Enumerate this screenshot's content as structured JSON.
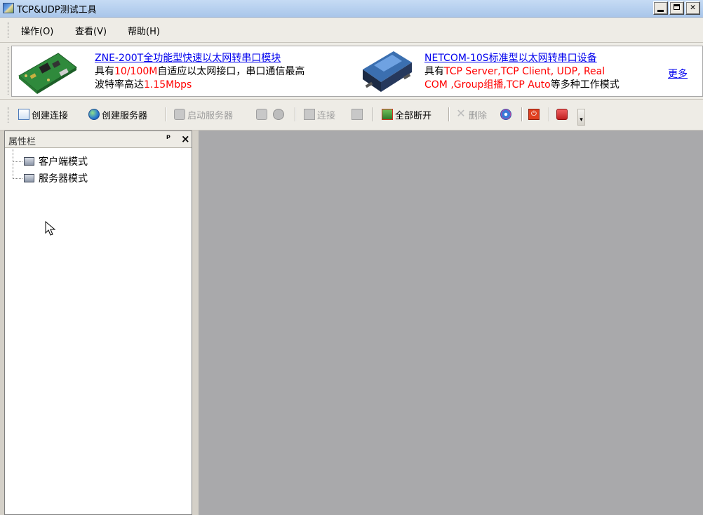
{
  "window": {
    "title": "TCP&UDP测试工具"
  },
  "menu": {
    "items": [
      "操作(O)",
      "查看(V)",
      "帮助(H)"
    ]
  },
  "ads": [
    {
      "title": "ZNE-200T全功能型快速以太网转串口模块",
      "line1_a": "具有",
      "line1_red": "10/100M",
      "line1_b": "自适应以太网接口，串口通信最高",
      "line2_a": "波特率高达",
      "line2_red": "1.15Mbps"
    },
    {
      "title": "NETCOM-10S标准型以太网转串口设备",
      "line1_a": "具有",
      "line1_red": "TCP Server,TCP Client, UDP, Real",
      "line2_red": "COM ,Group组播,TCP Auto",
      "line2_b": "等多种工作模式"
    }
  ],
  "more_link": "更多",
  "toolbar": {
    "create_connection": "创建连接",
    "create_server": "创建服务器",
    "start_server": "启动服务器",
    "connect": "连接",
    "disconnect_all": "全部断开",
    "delete": "删除"
  },
  "properties_pane": {
    "title": "属性栏",
    "pin_glyph": "ᵖ",
    "close_glyph": "×",
    "tree": [
      "客户端模式",
      "服务器模式"
    ]
  },
  "colors": {
    "highlight_red": "#ff0000",
    "link_blue": "#0000ee",
    "workspace_gray": "#a9a9ab"
  }
}
